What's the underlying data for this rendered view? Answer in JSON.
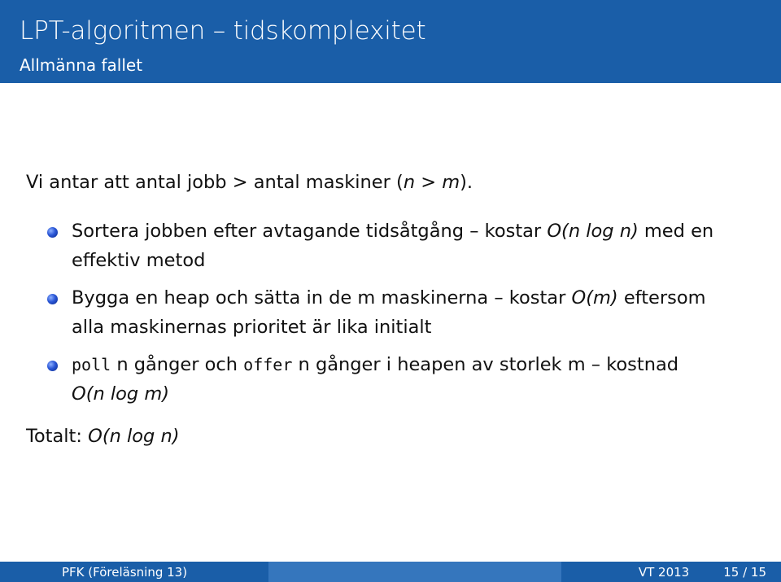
{
  "header": {
    "title": "LPT-algoritmen – tidskomplexitet",
    "subtitle": "Allmänna fallet"
  },
  "intro": {
    "text": "Vi antar att antal jobb > antal maskiner (",
    "math": "n > m",
    "end": ")."
  },
  "items": [
    {
      "line1_a": "Sortera jobben efter avtagande tidsåtgång – kostar ",
      "line1_math": "O(n log n)",
      "line1_b": " med en",
      "line2": "effektiv metod"
    },
    {
      "line1_a": "Bygga en heap och sätta in de m maskinerna – kostar ",
      "line1_math": "O(m)",
      "line1_b": " eftersom",
      "line2": "alla maskinernas prioritet är lika initialt"
    },
    {
      "code1": "poll",
      "t1": " n gånger och ",
      "code2": "offer",
      "t2": " n gånger i heapen av storlek m – kostnad",
      "line2_math": "O(n log m)"
    }
  ],
  "total": {
    "label": "Totalt: ",
    "math": "O(n log n)"
  },
  "footer": {
    "left": "PFK  (Föreläsning 13)",
    "term": "VT 2013",
    "page": "15 / 15"
  }
}
